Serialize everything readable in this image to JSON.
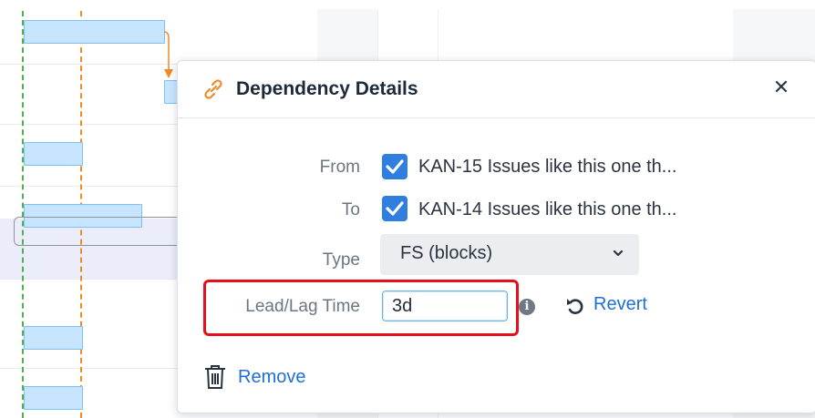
{
  "dialog": {
    "title": "Dependency Details",
    "close_glyph": "✕",
    "icon": "link-icon"
  },
  "form": {
    "from_label": "From",
    "from_value": "KAN-15 Issues like this one th...",
    "from_checked": true,
    "to_label": "To",
    "to_value": "KAN-14 Issues like this one th...",
    "to_checked": true,
    "type_label": "Type",
    "type_value": "FS (blocks)",
    "leadlag_label": "Lead/Lag Time",
    "leadlag_value": "3d",
    "info_glyph": "i",
    "revert_label": "Revert",
    "remove_label": "Remove"
  },
  "colors": {
    "accent_blue": "#2e7fe0",
    "link_blue": "#1e6fd6",
    "link_icon_orange": "#f08a24",
    "highlight_red": "#e5101c",
    "gantt_bar": "#c7e5ff",
    "today_line_green": "#4caf50",
    "dependency_orange": "#f08a24"
  }
}
